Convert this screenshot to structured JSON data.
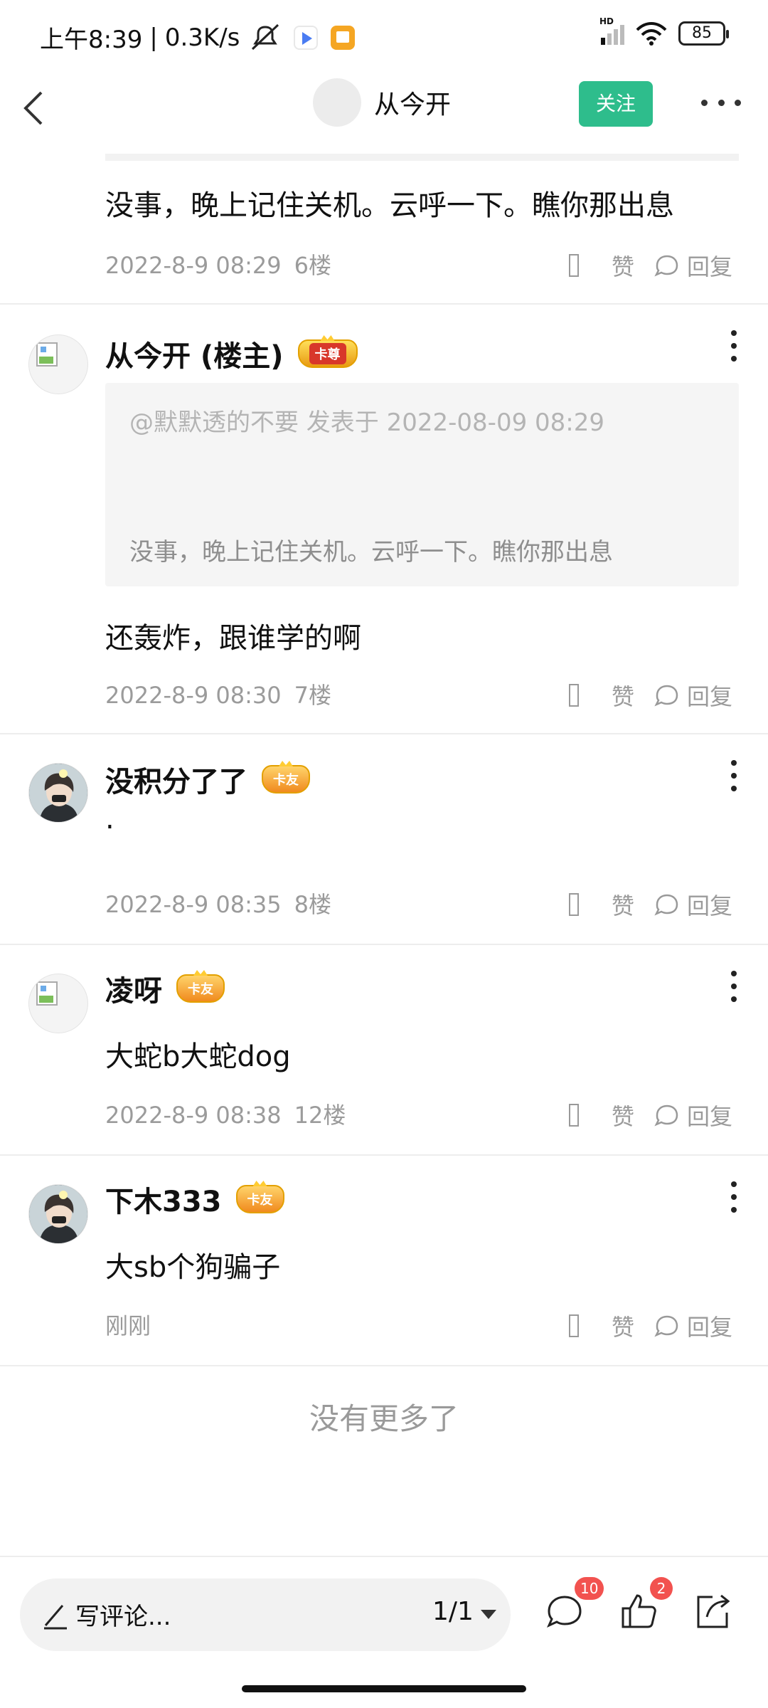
{
  "status_bar": {
    "time": "上午8:39",
    "net_speed": "0.3K/s",
    "signal_label": "HD",
    "battery": "85"
  },
  "nav": {
    "title": "从今开",
    "follow": "关注"
  },
  "comments": [
    {
      "text": "没事，晚上记住关机。云呼一下。瞧你那出息",
      "time": "2022-8-9 08:29",
      "floor": "6楼",
      "like": "赞",
      "reply": "回复"
    },
    {
      "name": "从今开 (楼主)",
      "badge": "卡尊",
      "quote_head": "@默默透的不要 发表于 2022-08-09 08:29",
      "quote_body": "没事，晚上记住关机。云呼一下。瞧你那出息",
      "text": "还轰炸，跟谁学的啊",
      "time": "2022-8-9 08:30",
      "floor": "7楼",
      "like": "赞",
      "reply": "回复"
    },
    {
      "name": "没积分了了",
      "badge": "卡友",
      "text": ".",
      "time": "2022-8-9 08:35",
      "floor": "8楼",
      "like": "赞",
      "reply": "回复"
    },
    {
      "name": "凌呀",
      "badge": "卡友",
      "text": "大蛇b大蛇dog",
      "time": "2022-8-9 08:38",
      "floor": "12楼",
      "like": "赞",
      "reply": "回复"
    },
    {
      "name": "下木333",
      "badge": "卡友",
      "text": "大sb个狗骗子",
      "time": "刚刚",
      "floor": "",
      "like": "赞",
      "reply": "回复"
    }
  ],
  "no_more": "没有更多了",
  "bottom_bar": {
    "placeholder": "写评论...",
    "pager": "1/1",
    "comment_count": "10",
    "like_count": "2"
  },
  "icons": [
    "back-icon",
    "more-icon",
    "reply-icon",
    "pen-icon",
    "comment-icon",
    "thumbs-up-icon",
    "share-icon"
  ],
  "colors": {
    "accent": "#2ebd8c",
    "badge_red": "#f2524f",
    "meta_gray": "#9b9b9b"
  }
}
